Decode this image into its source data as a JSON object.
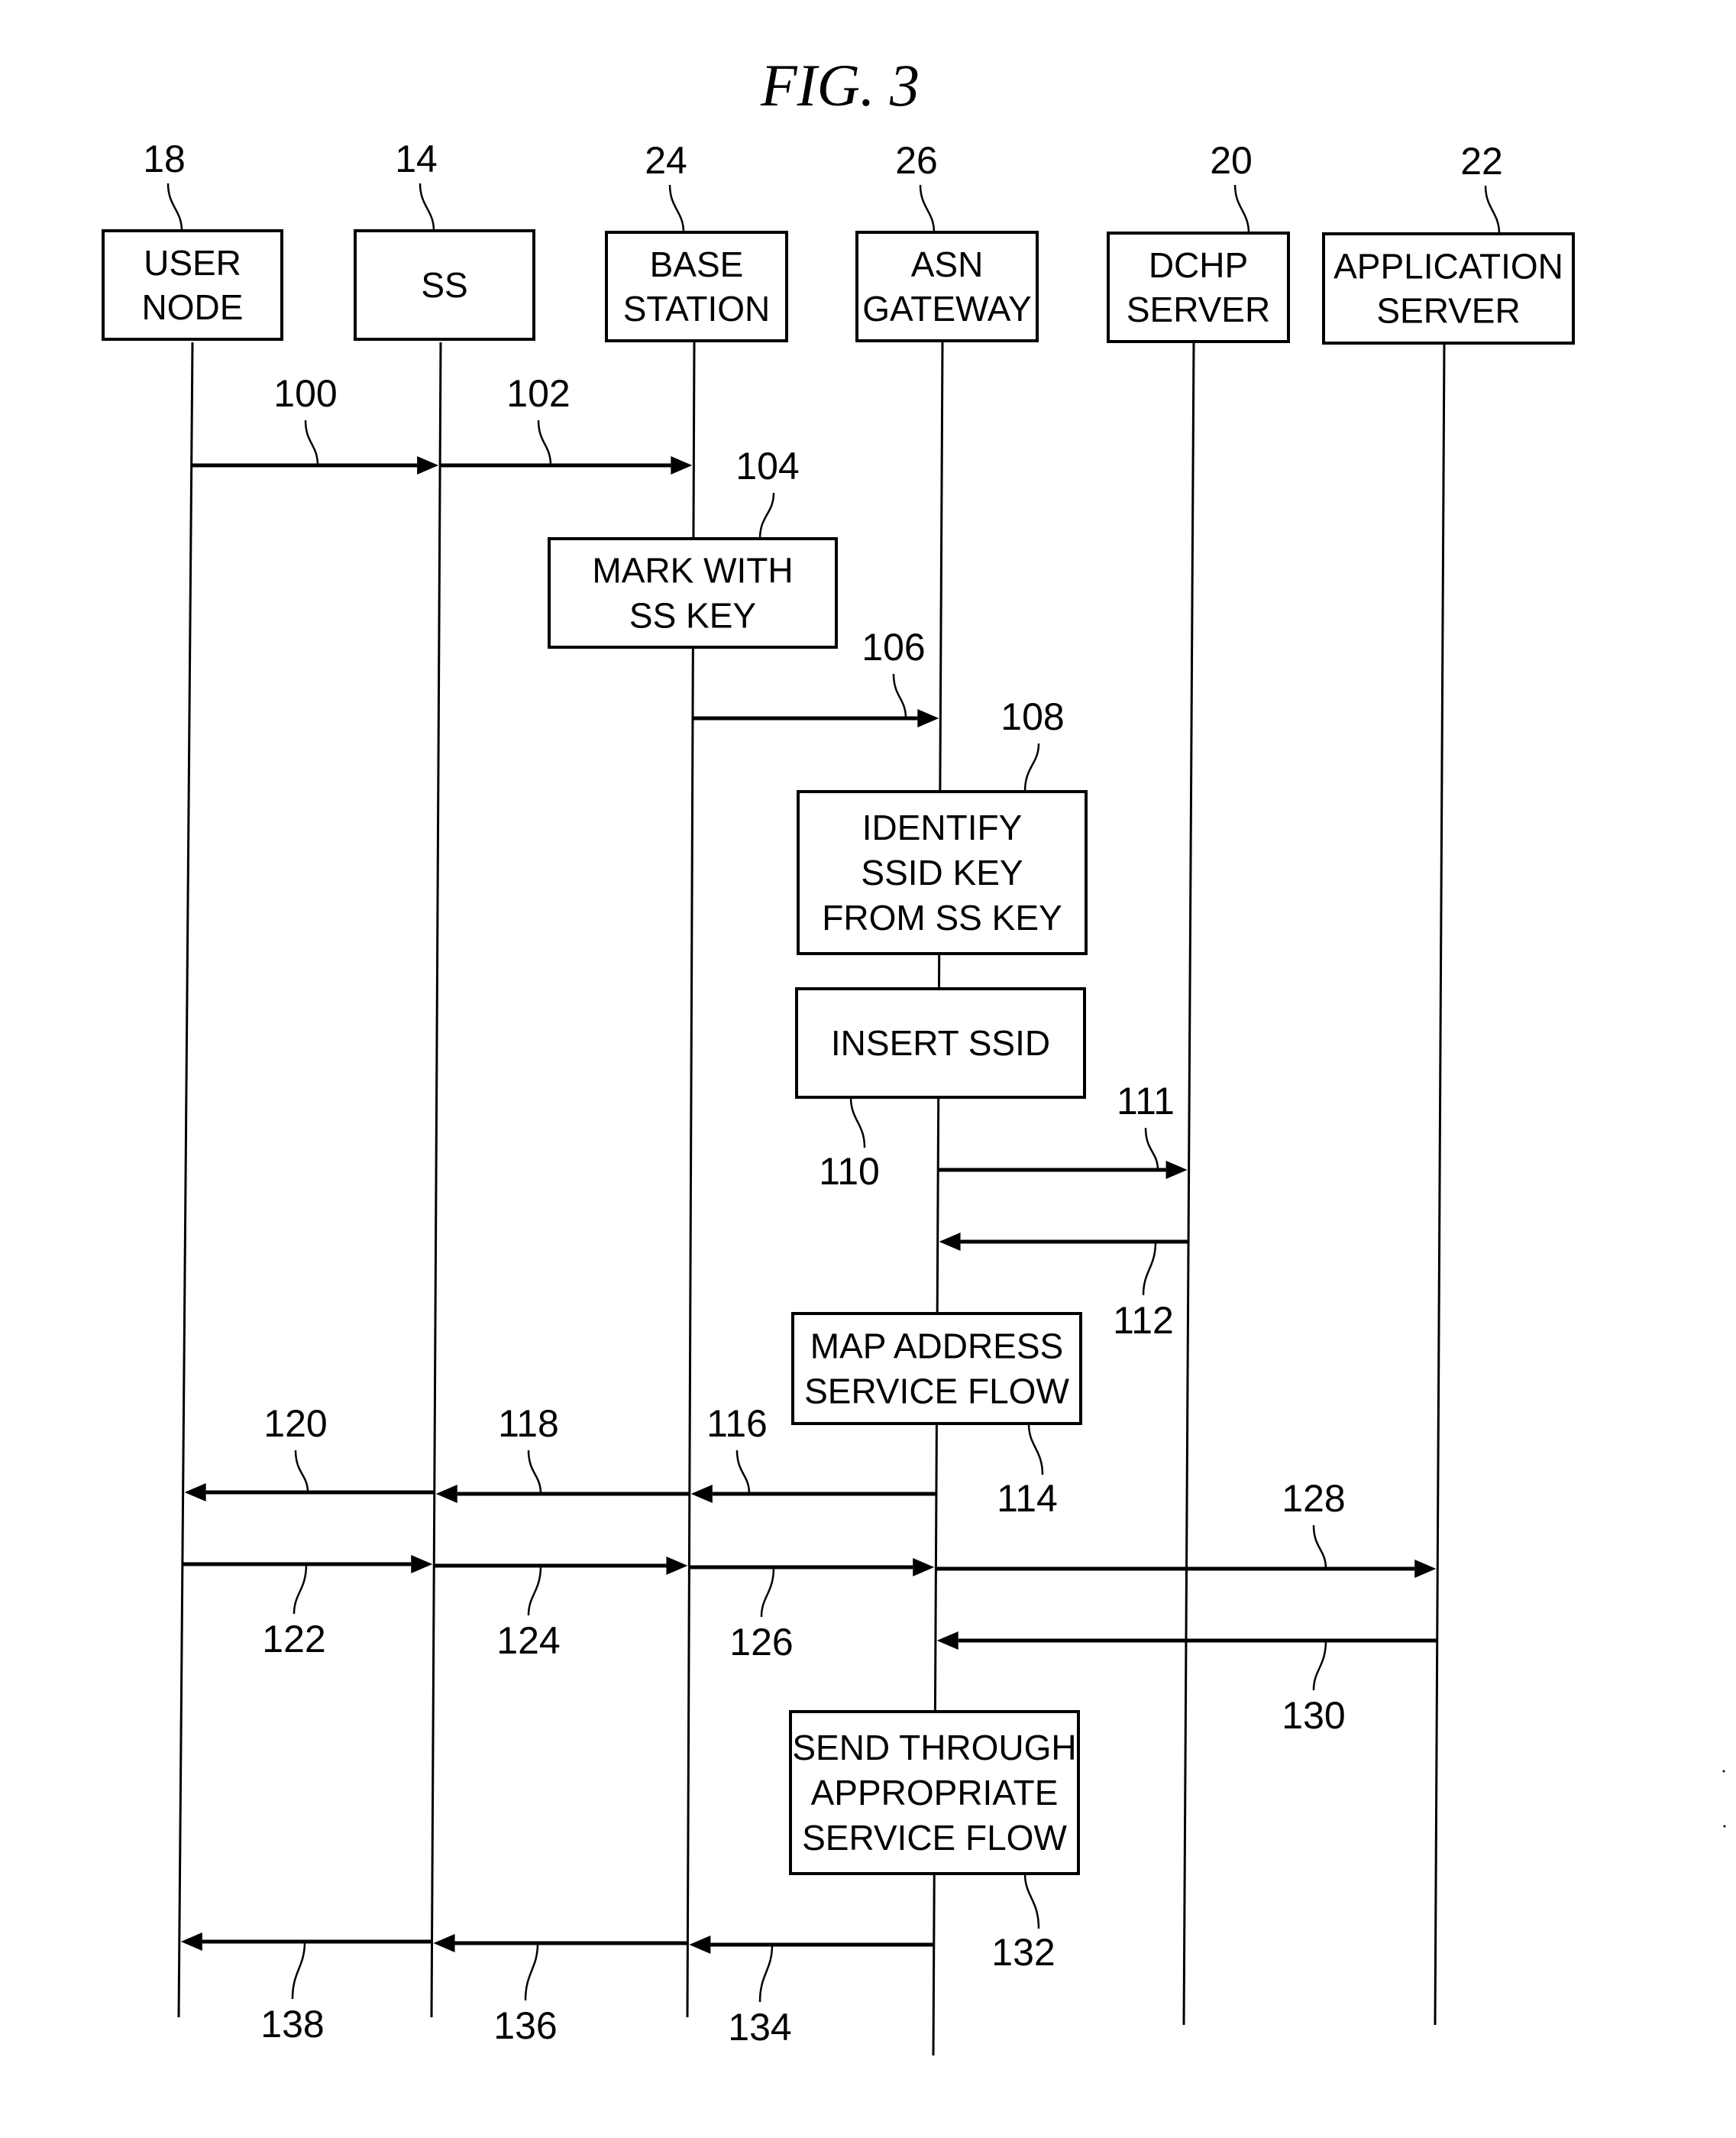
{
  "figure": {
    "title": "FIG. 3",
    "participants": [
      {
        "ref": "18",
        "lines": [
          "USER",
          "NODE"
        ]
      },
      {
        "ref": "14",
        "lines": [
          "SS"
        ]
      },
      {
        "ref": "24",
        "lines": [
          "BASE",
          "STATION"
        ]
      },
      {
        "ref": "26",
        "lines": [
          "ASN",
          "GATEWAY"
        ]
      },
      {
        "ref": "20",
        "lines": [
          "DCHP",
          "SERVER"
        ]
      },
      {
        "ref": "22",
        "lines": [
          "APPLICATION",
          "SERVER"
        ]
      }
    ],
    "steps": [
      {
        "ref": "100",
        "from": 0,
        "to": 1,
        "label_pos": "above"
      },
      {
        "ref": "102",
        "from": 1,
        "to": 2,
        "label_pos": "above"
      },
      {
        "ref": "104",
        "process": 2,
        "lines": [
          "MARK WITH",
          "SS KEY"
        ],
        "label_pos": "above"
      },
      {
        "ref": "106",
        "from": 2,
        "to": 3,
        "label_pos": "above"
      },
      {
        "ref": "108",
        "process": 3,
        "lines": [
          "IDENTIFY",
          "SSID KEY",
          "FROM SS KEY"
        ],
        "label_pos": "above"
      },
      {
        "ref": "110",
        "process": 3,
        "lines": [
          "INSERT SSID"
        ],
        "label_pos": "below"
      },
      {
        "ref": "111",
        "from": 3,
        "to": 4,
        "label_pos": "above"
      },
      {
        "ref": "112",
        "from": 4,
        "to": 3,
        "label_pos": "below"
      },
      {
        "ref": "114",
        "process": 3,
        "lines": [
          "MAP ADDRESS",
          "SERVICE FLOW"
        ],
        "label_pos": "below"
      },
      {
        "ref": "116",
        "from": 3,
        "to": 2,
        "label_pos": "above"
      },
      {
        "ref": "118",
        "from": 2,
        "to": 1,
        "label_pos": "above"
      },
      {
        "ref": "120",
        "from": 1,
        "to": 0,
        "label_pos": "above"
      },
      {
        "ref": "122",
        "from": 0,
        "to": 1,
        "label_pos": "below"
      },
      {
        "ref": "124",
        "from": 1,
        "to": 2,
        "label_pos": "below"
      },
      {
        "ref": "126",
        "from": 2,
        "to": 3,
        "label_pos": "below"
      },
      {
        "ref": "128",
        "from": 3,
        "to": 5,
        "label_pos": "above"
      },
      {
        "ref": "130",
        "from": 5,
        "to": 3,
        "label_pos": "below"
      },
      {
        "ref": "132",
        "process": 3,
        "lines": [
          "SEND THROUGH",
          "APPROPRIATE",
          "SERVICE FLOW"
        ],
        "label_pos": "below"
      },
      {
        "ref": "134",
        "from": 3,
        "to": 2,
        "label_pos": "below"
      },
      {
        "ref": "136",
        "from": 2,
        "to": 1,
        "label_pos": "below"
      },
      {
        "ref": "138",
        "from": 1,
        "to": 0,
        "label_pos": "below"
      }
    ]
  }
}
